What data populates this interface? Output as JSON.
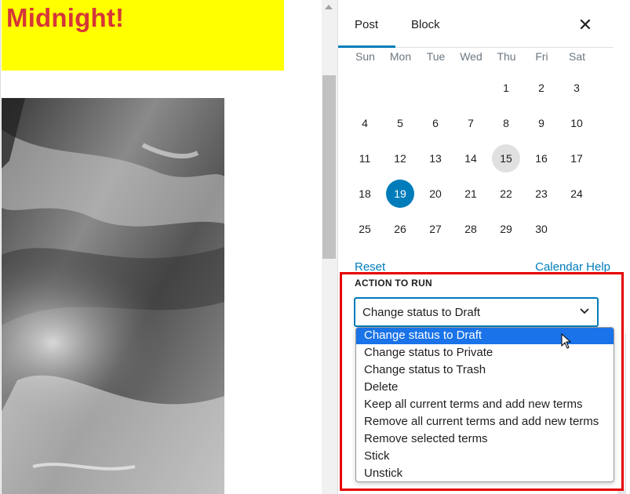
{
  "canvas": {
    "headline": "Midnight!"
  },
  "sidebar": {
    "tabs": [
      {
        "label": "Post",
        "active": true
      },
      {
        "label": "Block",
        "active": false
      }
    ],
    "close_icon": "close-icon",
    "calendar": {
      "weekdays": [
        "Sun",
        "Mon",
        "Tue",
        "Wed",
        "Thu",
        "Fri",
        "Sat"
      ],
      "weeks": [
        [
          "",
          "",
          "",
          "",
          "1",
          "2",
          "3"
        ],
        [
          "4",
          "5",
          "6",
          "7",
          "8",
          "9",
          "10"
        ],
        [
          "11",
          "12",
          "13",
          "14",
          "15",
          "16",
          "17"
        ],
        [
          "18",
          "19",
          "20",
          "21",
          "22",
          "23",
          "24"
        ],
        [
          "25",
          "26",
          "27",
          "28",
          "29",
          "30",
          ""
        ]
      ],
      "today": "15",
      "selected": "19",
      "reset_label": "Reset",
      "help_label": "Calendar Help"
    },
    "action": {
      "label": "ACTION TO RUN",
      "selected": "Change status to Draft",
      "options": [
        "Change status to Draft",
        "Change status to Private",
        "Change status to Trash",
        "Delete",
        "Keep all current terms and add new terms",
        "Remove all current terms and add new terms",
        "Remove selected terms",
        "Stick",
        "Unstick"
      ],
      "highlighted_option": "Change status to Draft"
    }
  },
  "colors": {
    "accent": "#007cba",
    "headline_bg": "#ffff00",
    "headline_text": "#d63638",
    "highlight_frame": "#e60000",
    "option_active_bg": "#1a73e8"
  }
}
